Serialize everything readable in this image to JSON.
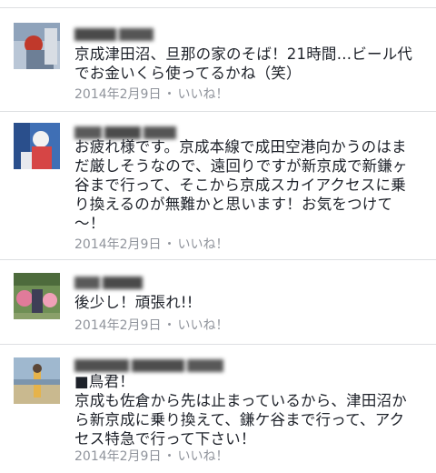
{
  "comments": [
    {
      "text": "京成津田沼、旦那の家のそば！21時間…ビール代\nでお金いくら使ってるかね（笑）",
      "date": "2014年2月9日",
      "separator": "・",
      "like_label": "いいね！"
    },
    {
      "text": "お疲れ様です。京成本線で成田空港向かうのはま\nだ厳しそうなので、遠回りですが新京成で新鎌ヶ\n谷まで行って、そこから京成スカイアクセスに乗\nり換えるのが無難かと思います！お気をつけて\n〜！",
      "date": "2014年2月9日",
      "separator": "・",
      "like_label": "いいね！"
    },
    {
      "text": "後少し！頑張れ!!",
      "date": "2014年2月9日",
      "separator": "・",
      "like_label": "いいね！"
    },
    {
      "text": "■鳥君！\n京成も佐倉から先は止まっているから、津田沼か\nら新京成に乗り換えて、鎌ケ谷まで行って、アク\nセス特急で行って下さい！",
      "date": "2014年2月9日",
      "separator": "・",
      "like_label": "いいね！"
    }
  ]
}
